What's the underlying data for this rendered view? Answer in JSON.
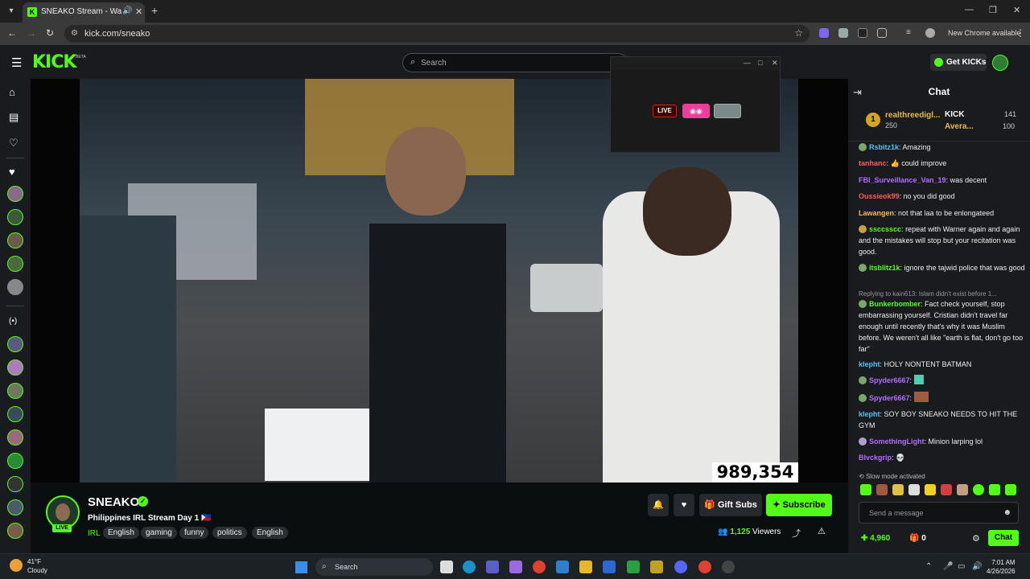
{
  "browser": {
    "tab_title": "SNEAKO Stream - Watch Live",
    "url": "kick.com/sneako",
    "new_chrome": "New Chrome available"
  },
  "header": {
    "logo": "KICK",
    "beta": "BETA",
    "search_placeholder": "Search",
    "get_kicks": "Get KICKs"
  },
  "popup": {
    "live_label": "LIVE"
  },
  "video": {
    "viewer_overlay": "989,354"
  },
  "channel": {
    "name": "SNEAKO",
    "live_badge": "LIVE",
    "stream_title": "Philippines IRL Stream Day 1 🇵🇭",
    "category": "IRL",
    "tags": [
      "English",
      "gaming",
      "funny",
      "politics",
      "English"
    ],
    "viewers_count": "1,125",
    "viewers_label": "Viewers",
    "gift_subs": "Gift Subs",
    "subscribe": "Subscribe"
  },
  "chat": {
    "title": "Chat",
    "leaderboard": {
      "first_user": "realthreedigl...",
      "first_value": "250",
      "second_user": "KICK",
      "second_value": "141",
      "third_user": "Avera...",
      "third_value": "100"
    },
    "messages": [
      {
        "user": "Rsbitz1k",
        "text": "Amazing",
        "color": "#4fc3f7"
      },
      {
        "user": "tanhanc",
        "text": "👍 could improve",
        "color": "#ff5c5c"
      },
      {
        "user": "FBI_Surveillance_Van_19",
        "text": "was decent",
        "color": "#b56cff"
      },
      {
        "user": "Oussieok99",
        "text": "no you did good",
        "color": "#ff5c5c"
      },
      {
        "user": "Lawangen",
        "text": "not that laa to be enlongateed",
        "color": "#ffb74d"
      },
      {
        "user": "ssccsscc",
        "text": "repeat with Warner again and again and the mistakes will stop but your recitation was good.",
        "color": "#53fc18"
      },
      {
        "user": "itsblitz1k",
        "text": "ignore the tajwid police that was good",
        "color": "#53fc18"
      },
      {
        "user": "Bunkerbomber",
        "text": "Fact check yourself, stop embarrassing yourself. Cristian didn't travel far enough until recently that's why it was Muslim before. We weren't all like \"earth is flat, don't go too far\"",
        "color": "#53fc18",
        "reply": "Replying to kain613: Islam didn't exist before 1..."
      },
      {
        "user": "klepht",
        "text": "HOLY NONTENT BATMAN",
        "color": "#4fc3f7"
      },
      {
        "user": "Spyder6667",
        "text": "",
        "color": "#b56cff"
      },
      {
        "user": "Spyder6667",
        "text": "",
        "color": "#b56cff"
      },
      {
        "user": "klepht",
        "text": "SOY BOY SNEAKO NEEDS TO HIT THE GYM",
        "color": "#4fc3f7"
      },
      {
        "user": "SomethingLight",
        "text": "Minion larping lol",
        "color": "#b56cff"
      },
      {
        "user": "Blvckgrip",
        "text": "",
        "color": "#b56cff"
      }
    ],
    "slow_mode": "Slow mode activated",
    "send_placeholder": "Send a message",
    "points": "4,960",
    "gifts": "0",
    "chat_button": "Chat"
  },
  "taskbar": {
    "weather_temp": "41°F",
    "weather_desc": "Cloudy",
    "search": "Search",
    "time": "7:01 AM",
    "date": "4/26/2026"
  },
  "colors": {
    "kick_green": "#53fc18",
    "bg": "#0b0e0f",
    "panel": "#191b1f"
  }
}
